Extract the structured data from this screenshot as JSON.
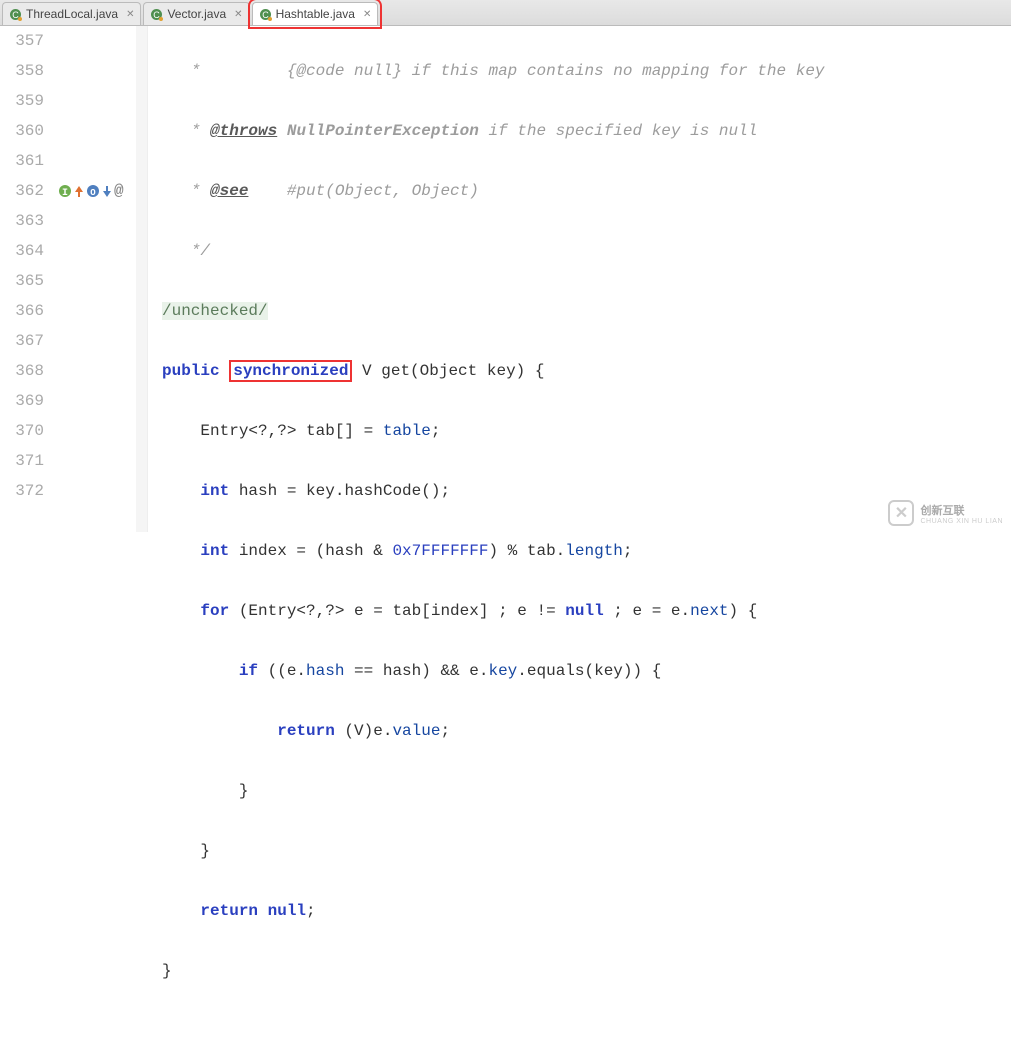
{
  "tabs": [
    {
      "label": "ThreadLocal.java",
      "active": false
    },
    {
      "label": "Vector.java",
      "active": false
    },
    {
      "label": "Hashtable.java",
      "active": true,
      "highlight": true
    }
  ],
  "gutter": {
    "start": 357,
    "lines": [
      "357",
      "358",
      "359",
      "360",
      "361",
      "362",
      "363",
      "364",
      "365",
      "366",
      "367",
      "368",
      "369",
      "370",
      "371",
      "372"
    ]
  },
  "code": {
    "l357": {
      "star": "*         ",
      "tag": "{@code null}",
      "rest": " if this map contains no mapping for the key"
    },
    "l358": {
      "star": "* ",
      "tag": "@throws",
      "cls": " NullPointerException ",
      "rest": "if the specified key is null"
    },
    "l359": {
      "star": "* ",
      "tag": "@see",
      "rest": "    #put(Object, Object)"
    },
    "l360": {
      "star": "*/"
    },
    "l361": {
      "text": "/unchecked/"
    },
    "l362": {
      "kw1": "public",
      "kw2": "synchronized",
      "rest1": " V get(Object key) {"
    },
    "l363": {
      "pre": "    Entry<?,?> tab[] = ",
      "fld": "table",
      "post": ";"
    },
    "l364": {
      "pre": "    ",
      "kw": "int",
      "mid": " hash = key.hashCode();"
    },
    "l365": {
      "pre": "    ",
      "kw": "int",
      "mid": " index = (hash & ",
      "num": "0x7FFFFFFF",
      "post": ") % tab.",
      "fld": "length",
      "end": ";"
    },
    "l366": {
      "pre": "    ",
      "kw": "for",
      "mid": " (Entry<?,?> e = tab[index] ; e != ",
      "kw2": "null",
      "mid2": " ; e = e.",
      "fld": "next",
      "end": ") {"
    },
    "l367": {
      "pre": "        ",
      "kw": "if",
      "mid": " ((e.",
      "fld1": "hash",
      "mid2": " == hash) && e.",
      "fld2": "key",
      "mid3": ".equals(key)) {"
    },
    "l368": {
      "pre": "            ",
      "kw": "return",
      "mid": " (V)e.",
      "fld": "value",
      "end": ";"
    },
    "l369": {
      "text": "        }"
    },
    "l370": {
      "text": "    }"
    },
    "l371": {
      "pre": "    ",
      "kw": "return",
      "sp": " ",
      "kw2": "null",
      "end": ";"
    },
    "l372": {
      "text": "}"
    }
  },
  "logo": {
    "brand": "创新互联",
    "sub": "CHUANG XIN HU LIAN"
  }
}
